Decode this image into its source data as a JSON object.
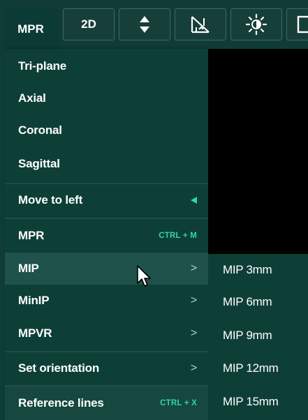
{
  "toolbar": {
    "mpr_label": "MPR",
    "twod_label": "2D",
    "icons": [
      "sort-arrows-icon",
      "ruler-angle-icon",
      "brightness-contrast-icon",
      "panel-icon"
    ]
  },
  "menu": {
    "items": [
      {
        "label": "Tri-plane"
      },
      {
        "label": "Axial"
      },
      {
        "label": "Coronal"
      },
      {
        "label": "Sagittal"
      },
      {
        "label": "Move to left"
      },
      {
        "label": "MPR",
        "shortcut": "CTRL + M"
      },
      {
        "label": "MIP",
        "arrow": ">"
      },
      {
        "label": "MinIP",
        "arrow": ">"
      },
      {
        "label": "MPVR",
        "arrow": ">"
      },
      {
        "label": "Set orientation",
        "arrow": ">"
      },
      {
        "label": "Reference lines",
        "shortcut": "CTRL + X"
      }
    ]
  },
  "submenu": {
    "items": [
      "MIP 3mm",
      "MIP 6mm",
      "MIP 9mm",
      "MIP 12mm",
      "MIP 15mm"
    ]
  },
  "colors": {
    "accent": "#2fd6a3",
    "menu_bg": "#0d3f37",
    "highlight_bg": "#1e524a"
  }
}
